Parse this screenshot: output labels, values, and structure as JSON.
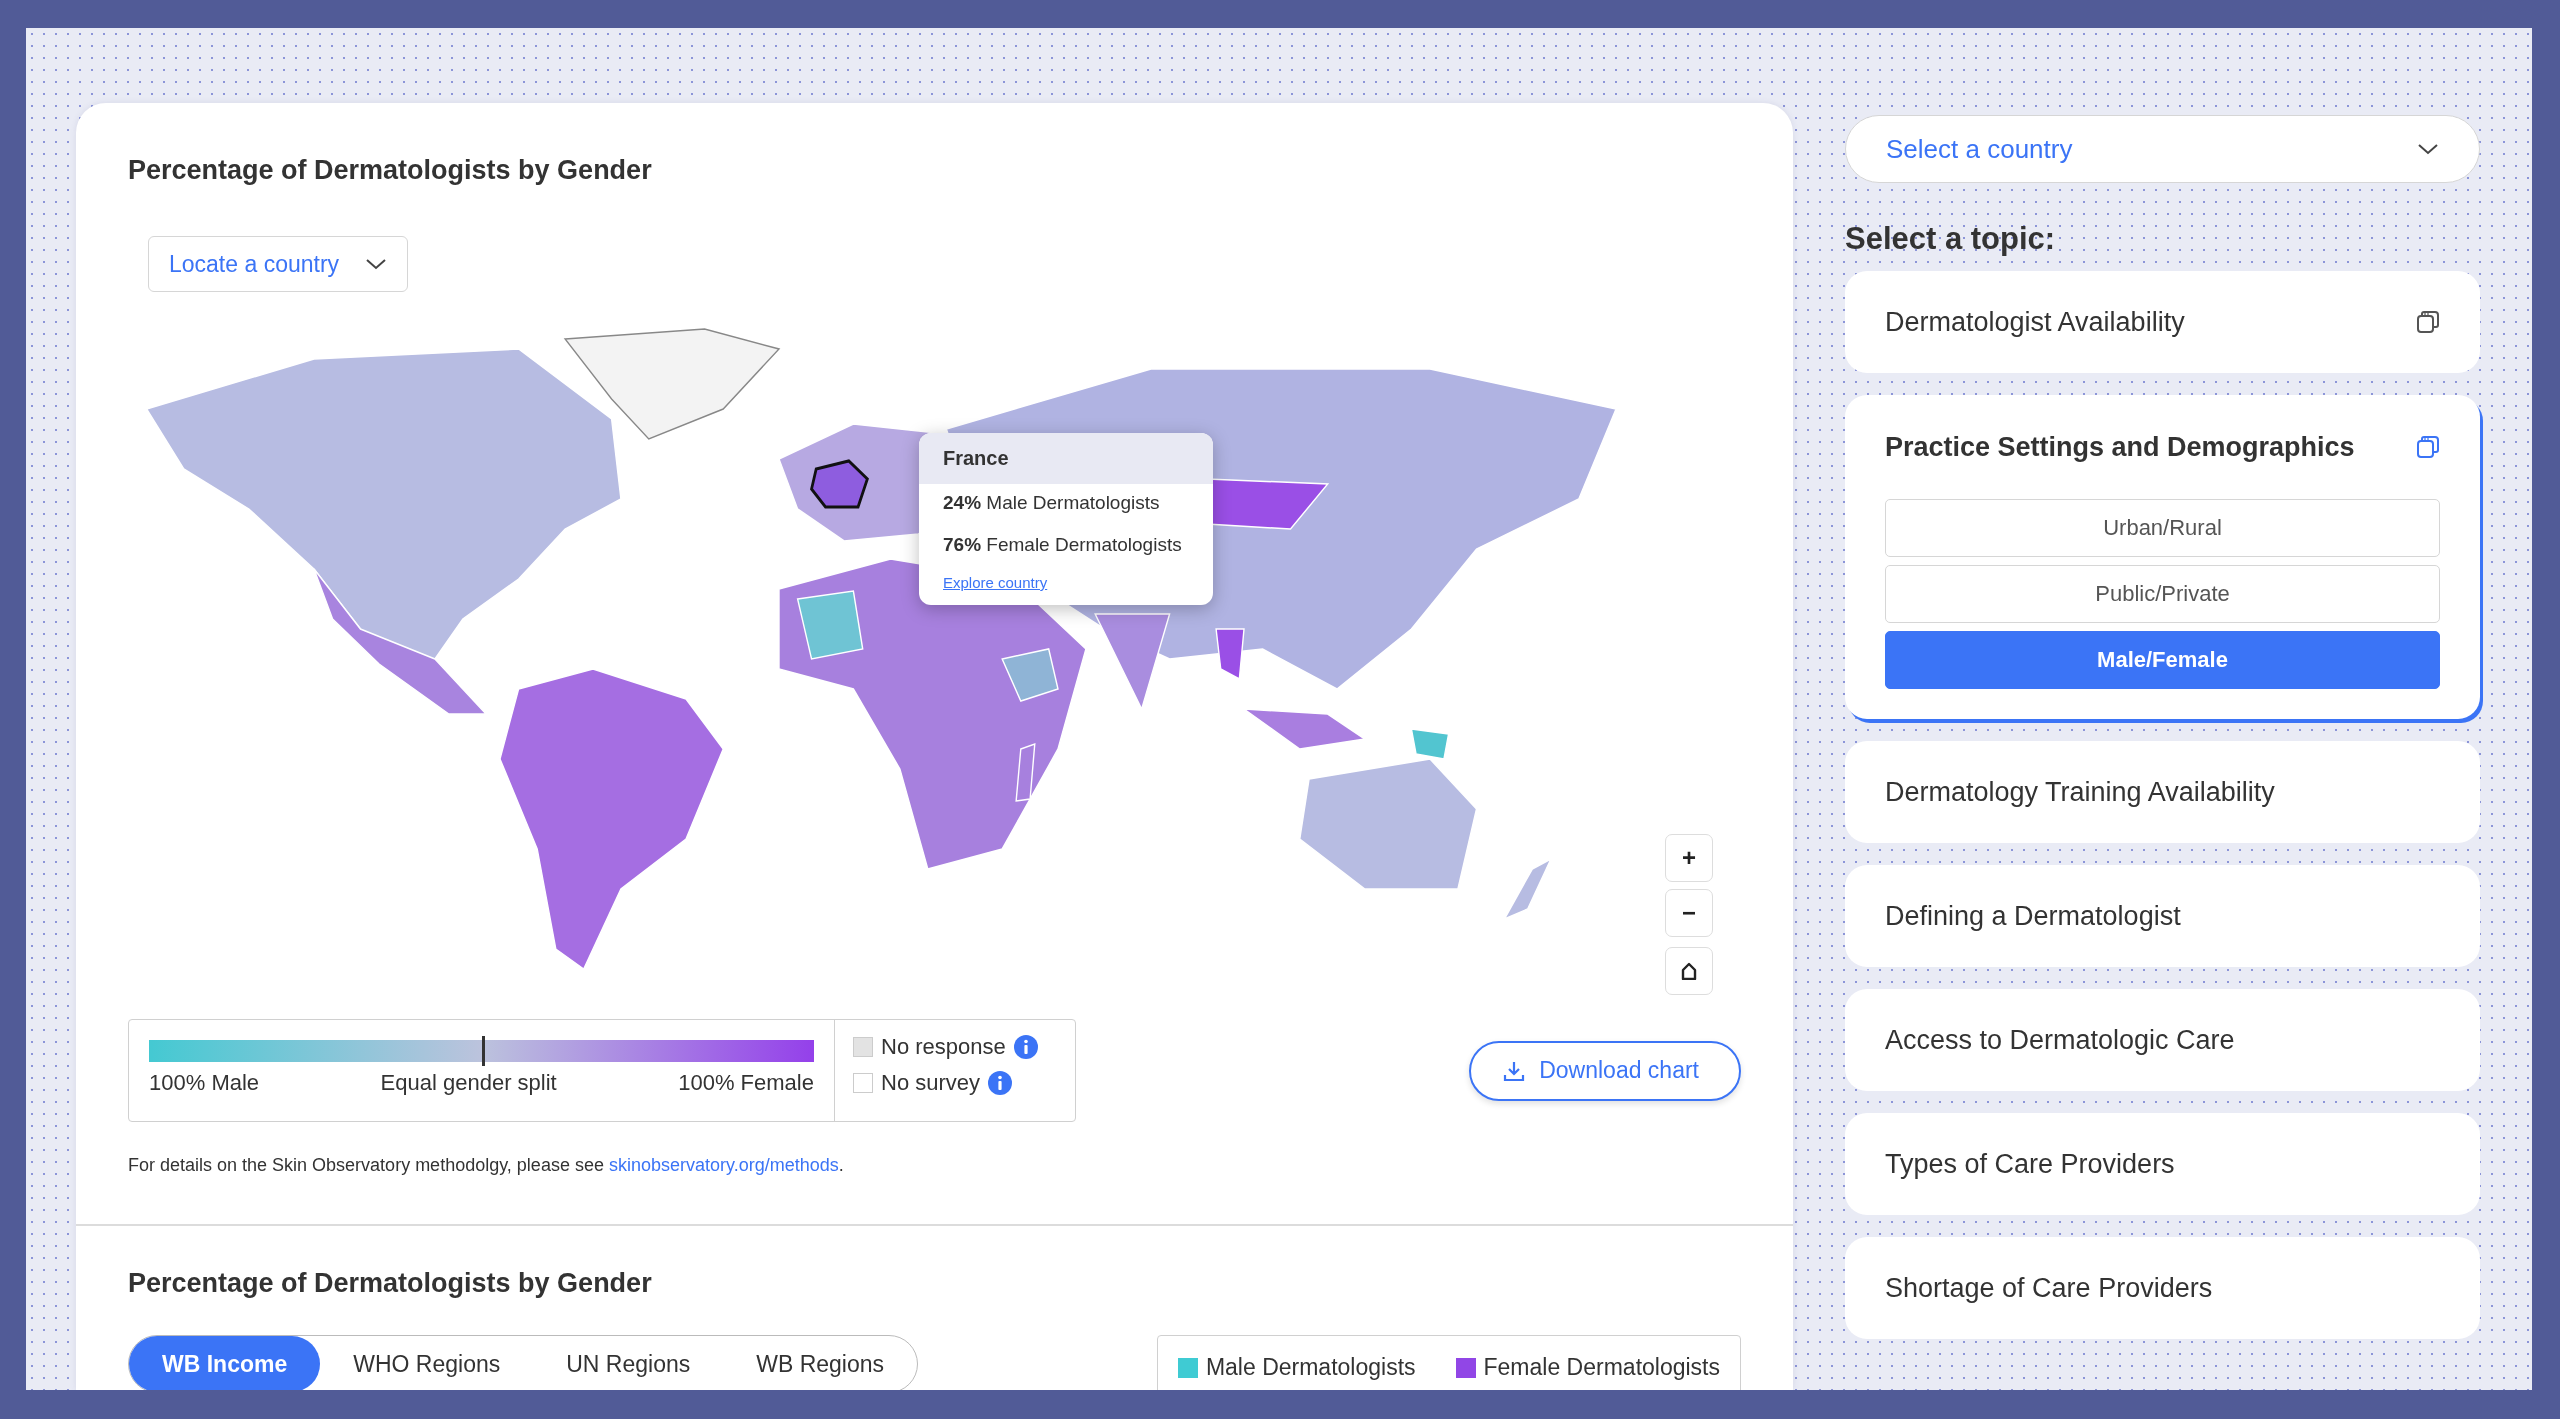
{
  "map_panel": {
    "title": "Percentage of Dermatologists by Gender",
    "locate": {
      "label": "Locate a country"
    },
    "tooltip": {
      "country": "France",
      "rows": [
        "**24%** Male Dermatologists",
        "**76%** Female Dermatologists"
      ],
      "link": "Explore country"
    },
    "zoom": {
      "zoom_in": "+",
      "zoom_out": "−"
    },
    "legend": {
      "labels": [
        "100% Male",
        "Equal gender split",
        "100% Female"
      ],
      "flags": [
        {
          "label": "No response",
          "color": "#e3e3e3"
        },
        {
          "label": "No survey",
          "color": "#ffffff"
        }
      ]
    },
    "download": {
      "label": "Download chart"
    },
    "note": {
      "text": "For details on the Skin Observatory methodolgy, please see ",
      "link": "skinobservatory.org/methods",
      "after": "."
    }
  },
  "region_panel": {
    "title": "Percentage of Dermatologists by Gender",
    "tabs": [
      {
        "label": "WB Income",
        "selected": true
      },
      {
        "label": "WHO Regions",
        "selected": false
      },
      {
        "label": "UN Regions",
        "selected": false
      },
      {
        "label": "WB Regions",
        "selected": false
      }
    ],
    "legend": [
      {
        "label": "Male Dermatologists",
        "color": "#3fcbd3"
      },
      {
        "label": "Female Dermatologists",
        "color": "#9146e6"
      }
    ]
  },
  "sidebar": {
    "country_select": {
      "label": "Select a country"
    },
    "heading": "Select a topic:",
    "topics": [
      {
        "label": "Dermatologist Availability",
        "kind": "group",
        "expanded": false
      },
      {
        "label": "Practice Settings and Demographics",
        "kind": "group",
        "expanded": true,
        "options": [
          {
            "label": "Urban/Rural",
            "selected": false
          },
          {
            "label": "Public/Private",
            "selected": false
          },
          {
            "label": "Male/Female",
            "selected": true
          }
        ]
      },
      {
        "label": "Dermatology Training Availability",
        "kind": "single",
        "expanded": false
      },
      {
        "label": "Defining a Dermatologist",
        "kind": "single",
        "expanded": false
      },
      {
        "label": "Access to Dermatologic Care",
        "kind": "single",
        "expanded": false
      },
      {
        "label": "Types of Care Providers",
        "kind": "single",
        "expanded": false
      },
      {
        "label": "Shortage of Care Providers",
        "kind": "single",
        "expanded": false
      }
    ]
  }
}
